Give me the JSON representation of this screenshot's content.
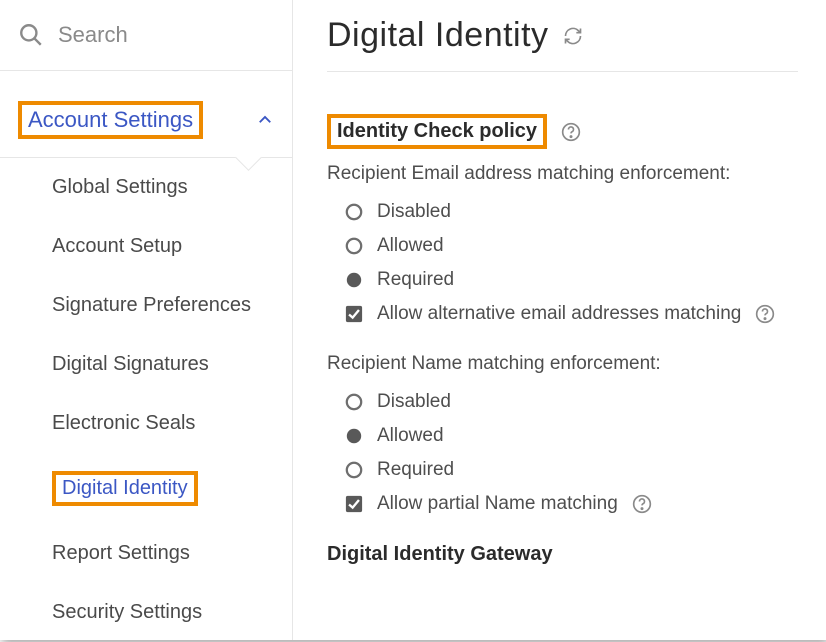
{
  "sidebar": {
    "search_placeholder": "Search",
    "section_label": "Account Settings",
    "expanded": true,
    "items": [
      {
        "label": "Global Settings",
        "active": false
      },
      {
        "label": "Account Setup",
        "active": false
      },
      {
        "label": "Signature Preferences",
        "active": false
      },
      {
        "label": "Digital Signatures",
        "active": false
      },
      {
        "label": "Electronic Seals",
        "active": false
      },
      {
        "label": "Digital Identity",
        "active": true
      },
      {
        "label": "Report Settings",
        "active": false
      },
      {
        "label": "Security Settings",
        "active": false
      }
    ]
  },
  "main": {
    "page_title": "Digital Identity",
    "section_heading": "Identity Check policy",
    "email_block": {
      "label": "Recipient Email address matching enforcement:",
      "options": [
        {
          "label": "Disabled",
          "selected": false
        },
        {
          "label": "Allowed",
          "selected": false
        },
        {
          "label": "Required",
          "selected": true
        }
      ],
      "checkbox": {
        "label": "Allow alternative email addresses matching",
        "checked": true,
        "has_help": true
      }
    },
    "name_block": {
      "label": "Recipient Name matching enforcement:",
      "options": [
        {
          "label": "Disabled",
          "selected": false
        },
        {
          "label": "Allowed",
          "selected": true
        },
        {
          "label": "Required",
          "selected": false
        }
      ],
      "checkbox": {
        "label": "Allow partial Name matching",
        "checked": true,
        "has_help": true
      }
    },
    "gateway_heading": "Digital Identity Gateway"
  },
  "colors": {
    "highlight": "#ee8a00",
    "link": "#3b57c4"
  }
}
